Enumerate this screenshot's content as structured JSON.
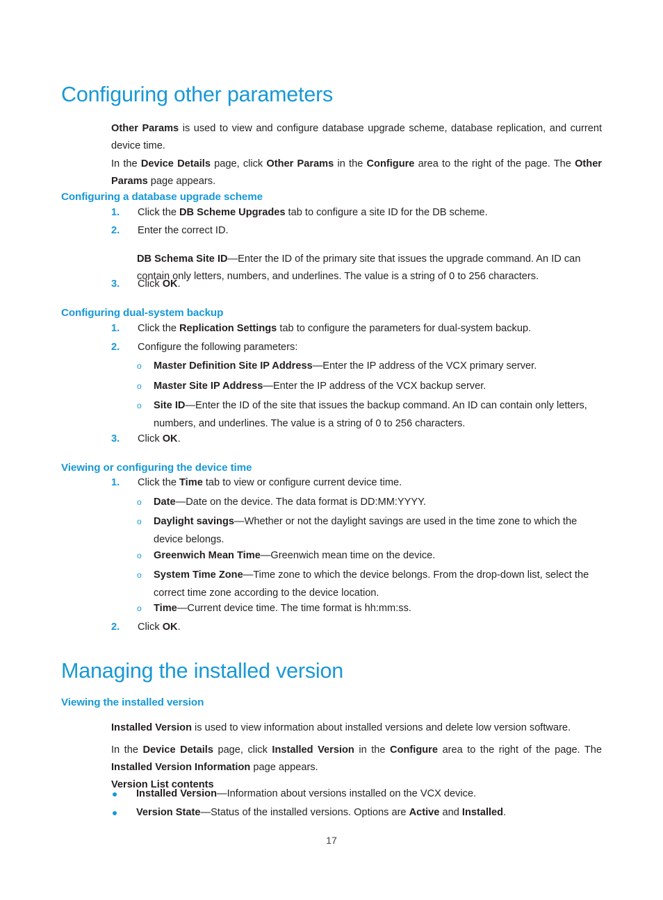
{
  "document": {
    "page_number": "17",
    "accent_color": "#1798d5",
    "text_color": "#231f20"
  },
  "sections": [
    {
      "id": "configuring-other-parameters",
      "heading": "Configuring other parameters",
      "intro": [
        {
          "runs": [
            {
              "text": "Other Params",
              "bold": true
            },
            {
              "text": " is used to view and configure database upgrade scheme, database replication, and current device time.",
              "bold": false
            }
          ]
        },
        {
          "runs": [
            {
              "text": "In the ",
              "bold": false
            },
            {
              "text": "Device Details",
              "bold": true
            },
            {
              "text": " page, click ",
              "bold": false
            },
            {
              "text": "Other Params",
              "bold": true
            },
            {
              "text": " in the ",
              "bold": false
            },
            {
              "text": "Configure",
              "bold": true
            },
            {
              "text": " area to the right of the page. The ",
              "bold": false
            },
            {
              "text": "Other Params",
              "bold": true
            },
            {
              "text": " page appears.",
              "bold": false
            }
          ]
        }
      ]
    }
  ],
  "sub_sections": {
    "db_upgrade": {
      "heading": "Configuring a database upgrade scheme",
      "steps": [
        {
          "marker": "1.",
          "runs": [
            {
              "text": "Click the ",
              "bold": false
            },
            {
              "text": "DB Scheme Upgrades",
              "bold": true
            },
            {
              "text": " tab to configure a site ID for the DB scheme.",
              "bold": false
            }
          ]
        },
        {
          "marker": "2.",
          "runs": [
            {
              "text": "Enter the correct ID.",
              "bold": false
            }
          ]
        },
        {
          "marker": "3.",
          "runs": [
            {
              "text": "Click ",
              "bold": false
            },
            {
              "text": "OK",
              "bold": true
            },
            {
              "text": ".",
              "bold": false
            }
          ]
        }
      ],
      "note": {
        "runs": [
          {
            "text": "DB Schema Site ID",
            "bold": true
          },
          {
            "text": "—Enter the ID of the primary site that issues the upgrade command. An ID can contain only letters, numbers, and underlines. The value is a string of 0 to 256 characters.",
            "bold": false
          }
        ]
      }
    },
    "dual_system_backup": {
      "heading": "Configuring dual-system backup",
      "steps": [
        {
          "marker": "1.",
          "runs": [
            {
              "text": "Click the ",
              "bold": false
            },
            {
              "text": "Replication Settings",
              "bold": true
            },
            {
              "text": " tab to configure the parameters for dual-system backup.",
              "bold": false
            }
          ]
        },
        {
          "marker": "2.",
          "runs": [
            {
              "text": "Configure the following parameters:",
              "bold": false
            }
          ]
        },
        {
          "marker": "3.",
          "runs": [
            {
              "text": "Click ",
              "bold": false
            },
            {
              "text": "OK",
              "bold": true
            },
            {
              "text": ".",
              "bold": false
            }
          ]
        }
      ],
      "params": [
        {
          "marker": "o",
          "runs": [
            {
              "text": "Master Definition Site IP Address",
              "bold": true
            },
            {
              "text": "—Enter the IP address of the VCX primary server.",
              "bold": false
            }
          ]
        },
        {
          "marker": "o",
          "runs": [
            {
              "text": "Master Site IP Address",
              "bold": true
            },
            {
              "text": "—Enter the IP address of the VCX backup server.",
              "bold": false
            }
          ]
        },
        {
          "marker": "o",
          "runs": [
            {
              "text": "Site ID",
              "bold": true
            },
            {
              "text": "—Enter the ID of the site that issues the backup command. An ID can contain only letters, numbers, and underlines. The value is a string of 0 to 256 characters.",
              "bold": false
            }
          ]
        }
      ]
    },
    "device_time": {
      "heading": "Viewing or configuring the device time",
      "steps": [
        {
          "marker": "1.",
          "runs": [
            {
              "text": "Click the ",
              "bold": false
            },
            {
              "text": "Time",
              "bold": true
            },
            {
              "text": " tab to view or configure current device time.",
              "bold": false
            }
          ]
        },
        {
          "marker": "2.",
          "runs": [
            {
              "text": "Click ",
              "bold": false
            },
            {
              "text": "OK",
              "bold": true
            },
            {
              "text": ".",
              "bold": false
            }
          ]
        }
      ],
      "params": [
        {
          "marker": "o",
          "runs": [
            {
              "text": "Date",
              "bold": true
            },
            {
              "text": "—Date on the device. The data format is DD:MM:YYYY.",
              "bold": false
            }
          ]
        },
        {
          "marker": "o",
          "runs": [
            {
              "text": "Daylight savings",
              "bold": true
            },
            {
              "text": "—Whether or not the daylight savings are used in the time zone to which the device belongs.",
              "bold": false
            }
          ]
        },
        {
          "marker": "o",
          "runs": [
            {
              "text": "Greenwich Mean Time",
              "bold": true
            },
            {
              "text": "—Greenwich mean time on the device.",
              "bold": false
            }
          ]
        },
        {
          "marker": "o",
          "runs": [
            {
              "text": "System Time Zone",
              "bold": true
            },
            {
              "text": "—Time zone to which the device belongs. From the drop-down list, select the correct time zone according to the device location.",
              "bold": false
            }
          ]
        },
        {
          "marker": "o",
          "runs": [
            {
              "text": "Time",
              "bold": true
            },
            {
              "text": "—Current device time. The time format is hh:mm:ss.",
              "bold": false
            }
          ]
        }
      ]
    },
    "managing_installed_version": {
      "heading": "Managing the installed version"
    },
    "viewing_installed_version": {
      "heading": "Viewing the installed version",
      "paragraphs": [
        {
          "runs": [
            {
              "text": "Installed Version",
              "bold": true
            },
            {
              "text": " is used to view information about installed versions and delete low version software.",
              "bold": false
            }
          ]
        },
        {
          "runs": [
            {
              "text": "In the ",
              "bold": false
            },
            {
              "text": "Device Details",
              "bold": true
            },
            {
              "text": " page, click ",
              "bold": false
            },
            {
              "text": "Installed Version",
              "bold": true
            },
            {
              "text": " in the ",
              "bold": false
            },
            {
              "text": "Configure",
              "bold": true
            },
            {
              "text": " area to the right of the page. The ",
              "bold": false
            },
            {
              "text": "Installed Version Information",
              "bold": true
            },
            {
              "text": " page appears.",
              "bold": false
            }
          ]
        },
        {
          "runs": [
            {
              "text": "Version List contents",
              "bold": true
            }
          ]
        }
      ],
      "bullets": [
        {
          "runs": [
            {
              "text": "Installed Version",
              "bold": true
            },
            {
              "text": "—Information about versions installed on the VCX device.",
              "bold": false
            }
          ]
        },
        {
          "runs": [
            {
              "text": "Version State",
              "bold": true
            },
            {
              "text": "—Status of the installed versions. Options are ",
              "bold": false
            },
            {
              "text": "Active",
              "bold": true
            },
            {
              "text": " and ",
              "bold": false
            },
            {
              "text": "Installed",
              "bold": true
            },
            {
              "text": ".",
              "bold": false
            }
          ]
        }
      ]
    }
  }
}
